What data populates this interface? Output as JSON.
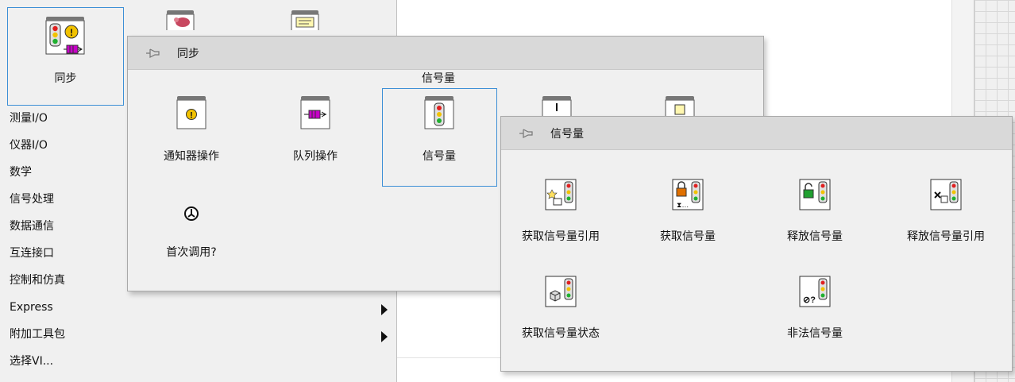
{
  "main_palette": {
    "sync_tile_label": "同步",
    "categories": [
      {
        "label": "测量I/O",
        "submenu": false
      },
      {
        "label": "仪器I/O",
        "submenu": false
      },
      {
        "label": "数学",
        "submenu": false
      },
      {
        "label": "信号处理",
        "submenu": false
      },
      {
        "label": "数据通信",
        "submenu": false
      },
      {
        "label": "互连接口",
        "submenu": false
      },
      {
        "label": "控制和仿真",
        "submenu": false
      },
      {
        "label": "Express",
        "submenu": true
      },
      {
        "label": "附加工具包",
        "submenu": true
      },
      {
        "label": "选择VI...",
        "submenu": false
      }
    ]
  },
  "sync_panel": {
    "title": "同步",
    "hover_label": "信号量",
    "items": [
      {
        "label": "通知器操作",
        "icon": "notifier-icon"
      },
      {
        "label": "队列操作",
        "icon": "queue-icon"
      },
      {
        "label": "信号量",
        "icon": "semaphore-icon"
      },
      {
        "label": "首次调用?",
        "icon": "first-call-icon"
      }
    ]
  },
  "semaphore_panel": {
    "title": "信号量",
    "items": [
      {
        "label": "获取信号量引用",
        "icon": "obtain-semaphore-reference-icon"
      },
      {
        "label": "获取信号量",
        "icon": "acquire-semaphore-icon"
      },
      {
        "label": "释放信号量",
        "icon": "release-semaphore-icon"
      },
      {
        "label": "释放信号量引用",
        "icon": "release-semaphore-reference-icon"
      },
      {
        "label": "获取信号量状态",
        "icon": "get-semaphore-status-icon"
      },
      {
        "label": "非法信号量",
        "icon": "not-a-semaphore-icon"
      }
    ]
  },
  "colors": {
    "selection": "#3d8fd6",
    "panel_bg": "#f0f0f0",
    "header_bg": "#d9d9d9",
    "light_red": "#e02020",
    "light_yellow": "#f2c200",
    "light_green": "#20b030",
    "queue_magenta": "#c800c8"
  }
}
